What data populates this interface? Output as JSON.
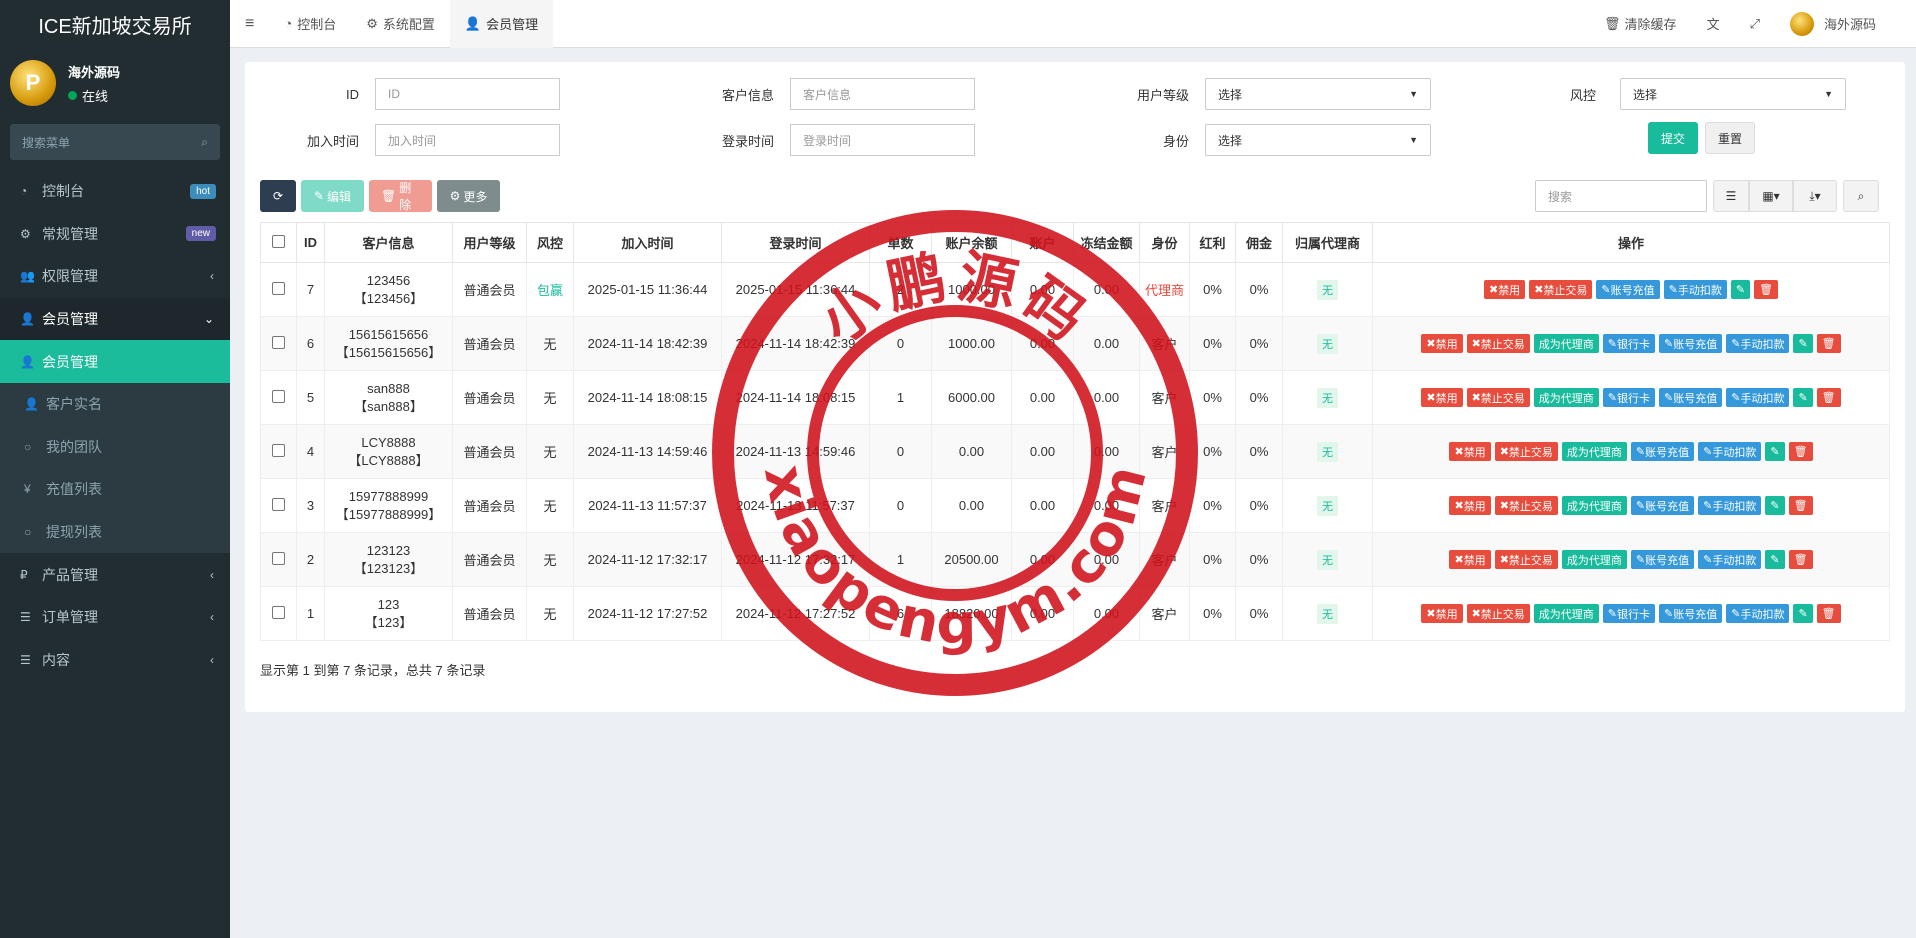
{
  "brand": "ICE新加坡交易所",
  "user": {
    "name": "海外源码",
    "status": "在线"
  },
  "sidebar": {
    "search_placeholder": "搜索菜单",
    "items": [
      {
        "label": "控制台",
        "badge": "hot",
        "badge_color": "#3c8dbc"
      },
      {
        "label": "常规管理",
        "badge": "new",
        "badge_color": "#605ca8"
      },
      {
        "label": "权限管理"
      },
      {
        "label": "会员管理"
      },
      {
        "label": "会员管理"
      },
      {
        "label": "客户实名"
      },
      {
        "label": "我的团队"
      },
      {
        "label": "充值列表"
      },
      {
        "label": "提现列表"
      },
      {
        "label": "产品管理"
      },
      {
        "label": "订单管理"
      },
      {
        "label": "内容"
      }
    ]
  },
  "topbar": {
    "tabs": [
      "控制台",
      "系统配置",
      "会员管理"
    ],
    "clear_cache": "清除缓存",
    "username": "海外源码"
  },
  "filters": {
    "id": {
      "label": "ID",
      "placeholder": "ID"
    },
    "customer": {
      "label": "客户信息",
      "placeholder": "客户信息"
    },
    "level": {
      "label": "用户等级",
      "value": "选择"
    },
    "risk": {
      "label": "风控",
      "value": "选择"
    },
    "join_time": {
      "label": "加入时间",
      "placeholder": "加入时间"
    },
    "login_time": {
      "label": "登录时间",
      "placeholder": "登录时间"
    },
    "identity": {
      "label": "身份",
      "value": "选择"
    },
    "submit": "提交",
    "reset": "重置"
  },
  "toolbar": {
    "edit": "编辑",
    "delete": "删除",
    "more": "更多",
    "search_placeholder": "搜索"
  },
  "table": {
    "headers": [
      "ID",
      "客户信息",
      "用户等级",
      "风控",
      "加入时间",
      "登录时间",
      "单数",
      "账户余额",
      "账户",
      "冻结金额",
      "身份",
      "红利",
      "佣金",
      "归属代理商",
      "操作"
    ],
    "rows": [
      {
        "id": "7",
        "name": "123456",
        "name2": "【123456】",
        "level": "普通会员",
        "risk": "包赢",
        "join": "2025-01-15 11:36:44",
        "login": "2025-01-15 11:36:44",
        "orders": "2",
        "balance": "1000.00",
        "acct": "0.00",
        "frozen": "0.00",
        "role": "代理商",
        "bonus": "0%",
        "comm": "0%",
        "agent": "无",
        "ops": [
          "禁用",
          "禁止交易",
          "账号充值",
          "手动扣款"
        ]
      },
      {
        "id": "6",
        "name": "15615615656",
        "name2": "【15615615656】",
        "level": "普通会员",
        "risk": "无",
        "join": "2024-11-14 18:42:39",
        "login": "2024-11-14 18:42:39",
        "orders": "0",
        "balance": "1000.00",
        "acct": "0.00",
        "frozen": "0.00",
        "role": "客户",
        "bonus": "0%",
        "comm": "0%",
        "agent": "无",
        "ops": [
          "禁用",
          "禁止交易",
          "成为代理商",
          "银行卡",
          "账号充值",
          "手动扣款"
        ]
      },
      {
        "id": "5",
        "name": "san888",
        "name2": "【san888】",
        "level": "普通会员",
        "risk": "无",
        "join": "2024-11-14 18:08:15",
        "login": "2024-11-14 18:08:15",
        "orders": "1",
        "balance": "6000.00",
        "acct": "0.00",
        "frozen": "0.00",
        "role": "客户",
        "bonus": "0%",
        "comm": "0%",
        "agent": "无",
        "ops": [
          "禁用",
          "禁止交易",
          "成为代理商",
          "银行卡",
          "账号充值",
          "手动扣款"
        ]
      },
      {
        "id": "4",
        "name": "LCY8888",
        "name2": "【LCY8888】",
        "level": "普通会员",
        "risk": "无",
        "join": "2024-11-13 14:59:46",
        "login": "2024-11-13 14:59:46",
        "orders": "0",
        "balance": "0.00",
        "acct": "0.00",
        "frozen": "0.00",
        "role": "客户",
        "bonus": "0%",
        "comm": "0%",
        "agent": "无",
        "ops": [
          "禁用",
          "禁止交易",
          "成为代理商",
          "账号充值",
          "手动扣款"
        ]
      },
      {
        "id": "3",
        "name": "15977888999",
        "name2": "【15977888999】",
        "level": "普通会员",
        "risk": "无",
        "join": "2024-11-13 11:57:37",
        "login": "2024-11-13 11:57:37",
        "orders": "0",
        "balance": "0.00",
        "acct": "0.00",
        "frozen": "0.00",
        "role": "客户",
        "bonus": "0%",
        "comm": "0%",
        "agent": "无",
        "ops": [
          "禁用",
          "禁止交易",
          "成为代理商",
          "账号充值",
          "手动扣款"
        ]
      },
      {
        "id": "2",
        "name": "123123",
        "name2": "【123123】",
        "level": "普通会员",
        "risk": "无",
        "join": "2024-11-12 17:32:17",
        "login": "2024-11-12 17:32:17",
        "orders": "1",
        "balance": "20500.00",
        "acct": "0.00",
        "frozen": "0.00",
        "role": "客户",
        "bonus": "0%",
        "comm": "0%",
        "agent": "无",
        "ops": [
          "禁用",
          "禁止交易",
          "成为代理商",
          "账号充值",
          "手动扣款"
        ]
      },
      {
        "id": "1",
        "name": "123",
        "name2": "【123】",
        "level": "普通会员",
        "risk": "无",
        "join": "2024-11-12 17:27:52",
        "login": "2024-11-12 17:27:52",
        "orders": "6",
        "balance": "18820.00",
        "acct": "0.00",
        "frozen": "0.00",
        "role": "客户",
        "bonus": "0%",
        "comm": "0%",
        "agent": "无",
        "ops": [
          "禁用",
          "禁止交易",
          "成为代理商",
          "银行卡",
          "账号充值",
          "手动扣款"
        ]
      }
    ]
  },
  "pagination": "显示第 1 到第 7 条记录，总共 7 条记录",
  "watermark": {
    "top": "小鹏源码",
    "bottom": "xiaopengym.com",
    "color": "#d0121b"
  }
}
